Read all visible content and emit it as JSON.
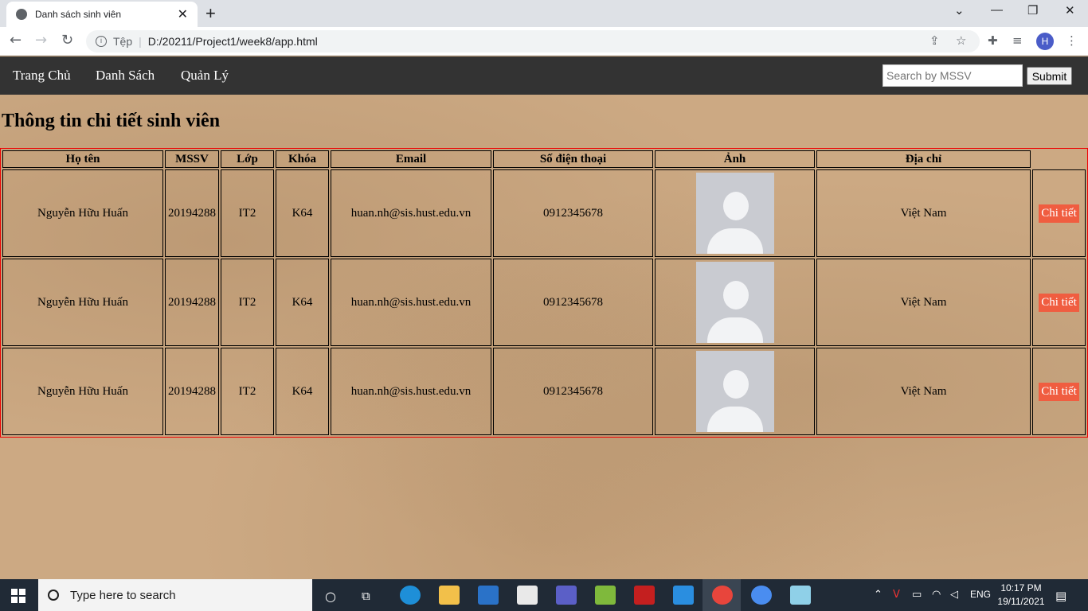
{
  "browser": {
    "tab_title": "Danh sách sinh viên",
    "tab_close": "✕",
    "new_tab": "+",
    "url_prefix": "Tệp",
    "url": "D:/20211/Project1/week8/app.html",
    "profile_initial": "H"
  },
  "nav": {
    "items": [
      "Trang Chủ",
      "Danh Sách",
      "Quản Lý"
    ],
    "search_placeholder": "Search by MSSV",
    "submit_label": "Submit"
  },
  "page": {
    "title": "Thông tin chi tiết sinh viên"
  },
  "table": {
    "headers": [
      "Họ tên",
      "MSSV",
      "Lớp",
      "Khóa",
      "Email",
      "Số điện thoại",
      "Ảnh",
      "Địa chỉ"
    ],
    "rows": [
      {
        "name": "Nguyễn Hữu Huấn",
        "mssv": "20194288",
        "class": "IT2",
        "course": "K64",
        "email": "huan.nh@sis.hust.edu.vn",
        "phone": "0912345678",
        "address": "Việt Nam",
        "action": "Chi tiết"
      },
      {
        "name": "Nguyễn Hữu Huấn",
        "mssv": "20194288",
        "class": "IT2",
        "course": "K64",
        "email": "huan.nh@sis.hust.edu.vn",
        "phone": "0912345678",
        "address": "Việt Nam",
        "action": "Chi tiết"
      },
      {
        "name": "Nguyễn Hữu Huấn",
        "mssv": "20194288",
        "class": "IT2",
        "course": "K64",
        "email": "huan.nh@sis.hust.edu.vn",
        "phone": "0912345678",
        "address": "Việt Nam",
        "action": "Chi tiết"
      }
    ]
  },
  "taskbar": {
    "search_placeholder": "Type here to search",
    "language": "ENG",
    "time": "10:17 PM",
    "date": "19/11/2021"
  }
}
